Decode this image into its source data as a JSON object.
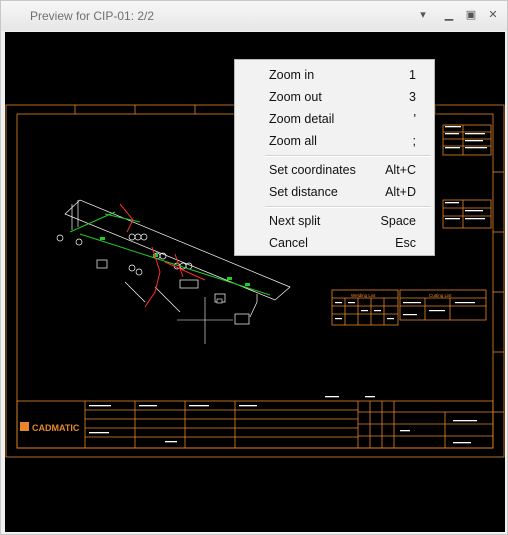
{
  "window": {
    "title": "Preview for CIP-01: 2/2"
  },
  "titlebar_buttons": {
    "dropdown": "▾",
    "minimize": "▁",
    "maximize": "▣",
    "close": "✕"
  },
  "colors": {
    "frame": "#e8862a",
    "pipe": "#22cc22",
    "mark": "#ff2a2a",
    "line": "#ffffff",
    "background": "#000000"
  },
  "drawing": {
    "logo": "CADMATIC",
    "welding_list": "Welding List",
    "cutting_list": "Cutting List"
  },
  "context_menu": {
    "groups": [
      [
        {
          "label": "Zoom in",
          "shortcut": "1"
        },
        {
          "label": "Zoom out",
          "shortcut": "3"
        },
        {
          "label": "Zoom detail",
          "shortcut": "'"
        },
        {
          "label": "Zoom all",
          "shortcut": ";"
        }
      ],
      [
        {
          "label": "Set coordinates",
          "shortcut": "Alt+C"
        },
        {
          "label": "Set distance",
          "shortcut": "Alt+D"
        }
      ],
      [
        {
          "label": "Next split",
          "shortcut": "Space"
        },
        {
          "label": "Cancel",
          "shortcut": "Esc"
        }
      ]
    ]
  }
}
